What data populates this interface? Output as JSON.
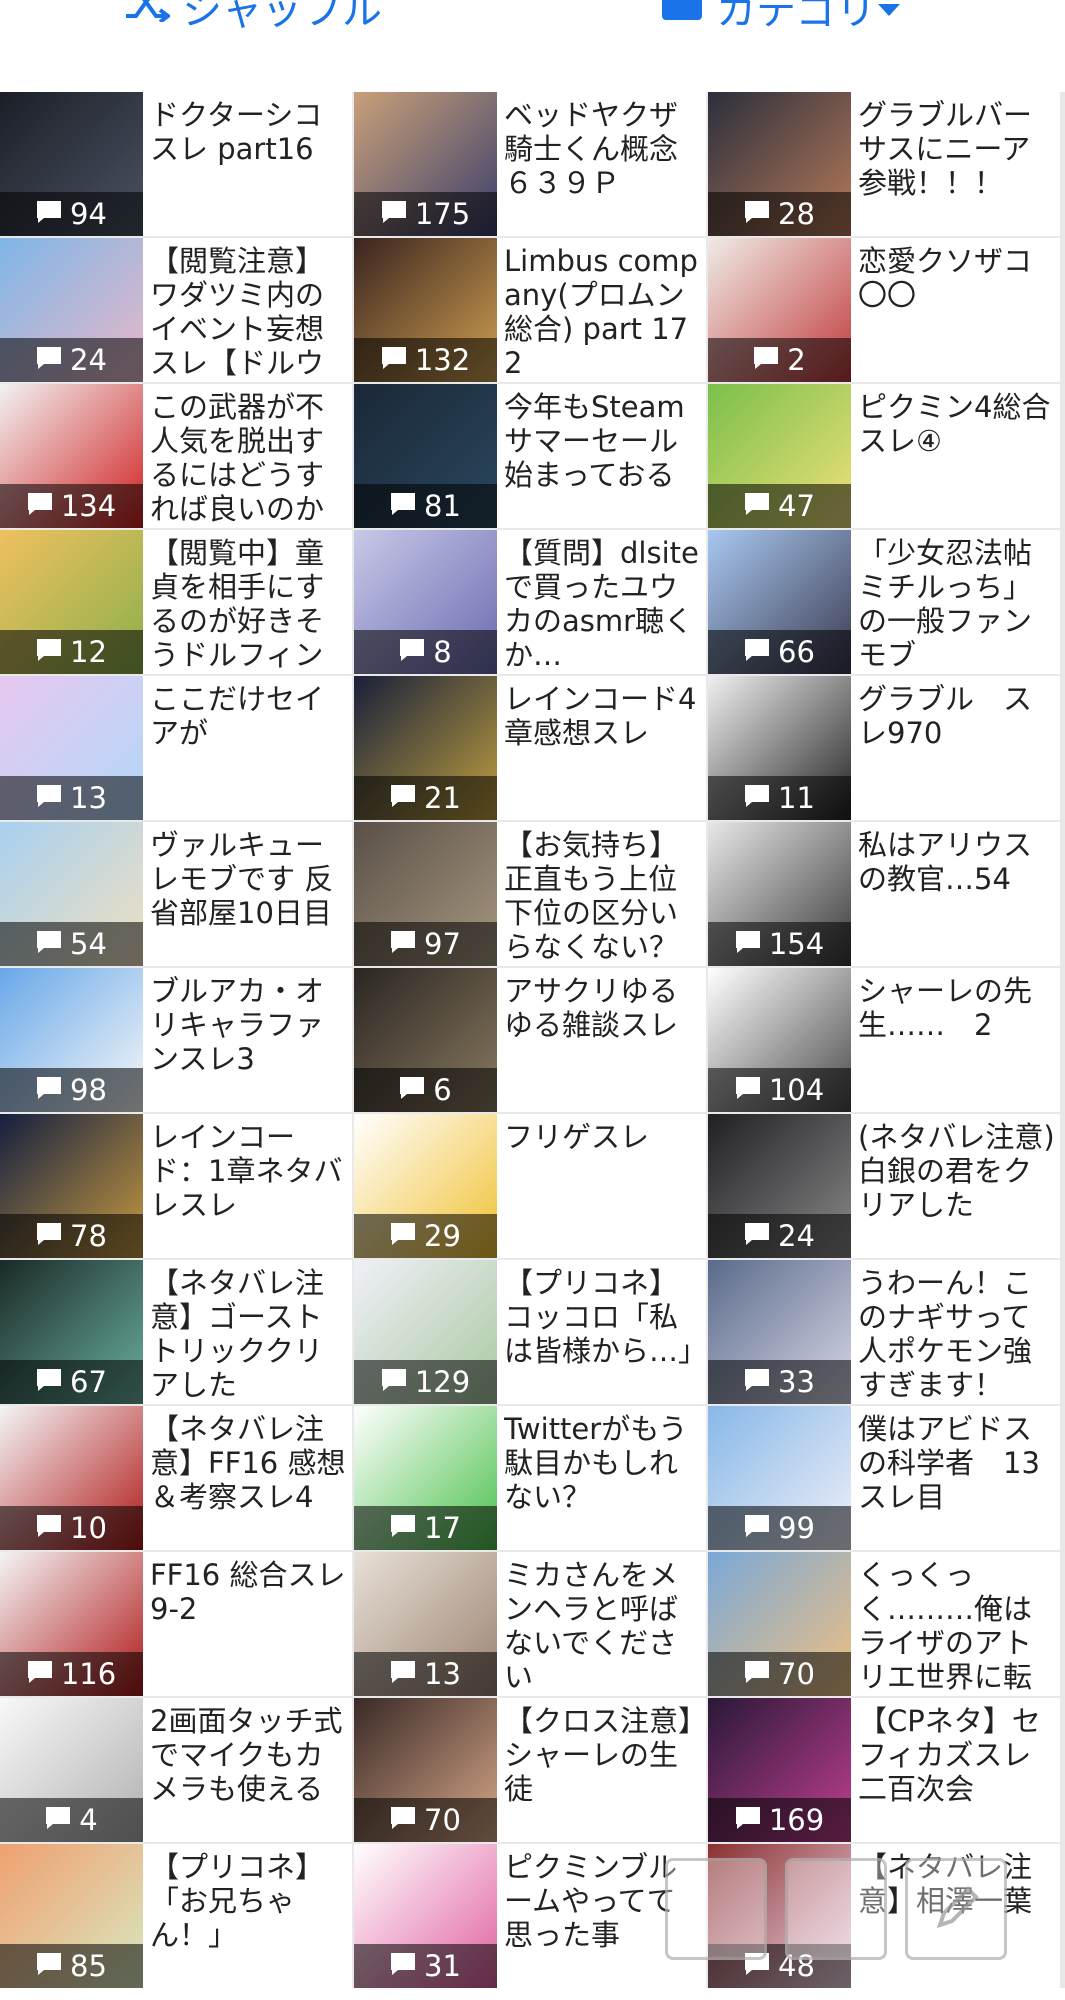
{
  "topbar": {
    "shuffle_label": "シャッフル",
    "category_label": "カテゴリ",
    "accent": "#1a73e8"
  },
  "threads": [
    {
      "title": "ドクターシコスレ part16",
      "count": "94",
      "thumb": [
        "#1c1f26",
        "#4a5364"
      ]
    },
    {
      "title": "ベッドヤクザ騎士くん概念 ６３９Ｐ",
      "count": "175",
      "thumb": [
        "#c9a07a",
        "#3b3f6b"
      ]
    },
    {
      "title": "グラブルバーサスにニーア参戦！！！",
      "count": "28",
      "thumb": [
        "#2b2f3c",
        "#b87a5a"
      ]
    },
    {
      "title": "【閲覧注意】ワダツミ内のイベント妄想スレ【ドルウ",
      "count": "24",
      "thumb": [
        "#7fb6e8",
        "#e8b8c8"
      ]
    },
    {
      "title": "Limbus company(プロムン総合) part 172",
      "count": "132",
      "thumb": [
        "#3a2420",
        "#d0a050"
      ]
    },
    {
      "title": "恋愛クソザコ〇〇",
      "count": "2",
      "thumb": [
        "#f0ebe6",
        "#c03a3a"
      ]
    },
    {
      "title": "この武器が不人気を脱出するにはどうすれば良いのか",
      "count": "134",
      "thumb": [
        "#f2f2f2",
        "#d02020"
      ]
    },
    {
      "title": "今年もSteamサマーセール始まっておる",
      "count": "81",
      "thumb": [
        "#1b2838",
        "#2a475e"
      ]
    },
    {
      "title": "ピクミン4総合スレ④",
      "count": "47",
      "thumb": [
        "#7ac04a",
        "#f0e07a"
      ]
    },
    {
      "title": "【閲覧中】童貞を相手にするのが好きそうドルフィン",
      "count": "12",
      "thumb": [
        "#f0c060",
        "#8ab04a"
      ]
    },
    {
      "title": "【質問】dlsiteで買ったユウカのasmr聴くか…",
      "count": "8",
      "thumb": [
        "#c8c8e8",
        "#6a6ab0"
      ]
    },
    {
      "title": "「少女忍法帖ミチルっち」の一般ファンモブ",
      "count": "66",
      "thumb": [
        "#a8c8f0",
        "#3a3a50"
      ]
    },
    {
      "title": "ここだけセイアが",
      "count": "13",
      "thumb": [
        "#e8c8f0",
        "#b0d8f8"
      ]
    },
    {
      "title": "レインコード4章感想スレ",
      "count": "21",
      "thumb": [
        "#18203a",
        "#c0a040"
      ]
    },
    {
      "title": "グラブル　スレ970",
      "count": "11",
      "thumb": [
        "#f0f0f0",
        "#222222"
      ]
    },
    {
      "title": "ヴァルキューレモブです 反省部屋10日目",
      "count": "54",
      "thumb": [
        "#a8d0f0",
        "#f0e0c0"
      ]
    },
    {
      "title": "【お気持ち】正直もう上位下位の区分いらなくない？",
      "count": "97",
      "thumb": [
        "#5a5048",
        "#a89880"
      ]
    },
    {
      "title": "私はアリウスの教官…54",
      "count": "154",
      "thumb": [
        "#e8e8e8",
        "#3a3a3a"
      ]
    },
    {
      "title": "ブルアカ・オリキャラファンスレ3",
      "count": "98",
      "thumb": [
        "#68a8e8",
        "#f8f8f8"
      ]
    },
    {
      "title": "アサクリゆるゆる雑談スレ",
      "count": "6",
      "thumb": [
        "#2a2622",
        "#8a7a60"
      ]
    },
    {
      "title": "シャーレの先生……　2",
      "count": "104",
      "thumb": [
        "#ffffff",
        "#4a4a4a"
      ]
    },
    {
      "title": "レインコード：1章ネタバレスレ",
      "count": "78",
      "thumb": [
        "#142040",
        "#c89a40"
      ]
    },
    {
      "title": "フリゲスレ",
      "count": "29",
      "thumb": [
        "#ffffff",
        "#f0c030"
      ]
    },
    {
      "title": "(ネタバレ注意)白銀の君をクリアした",
      "count": "24",
      "thumb": [
        "#202024",
        "#8a8a8a"
      ]
    },
    {
      "title": "【ネタバレ注意】ゴーストトリッククリアした",
      "count": "67",
      "thumb": [
        "#1a2a28",
        "#6ab0a0"
      ]
    },
    {
      "title": "【プリコネ】コッコロ「私は皆様から…」",
      "count": "129",
      "thumb": [
        "#f0f0f8",
        "#a8c8a0"
      ]
    },
    {
      "title": "うわーん！このナギサって人ポケモン強すぎます！",
      "count": "33",
      "thumb": [
        "#5a6a8a",
        "#d8d8e8"
      ]
    },
    {
      "title": "【ネタバレ注意】FF16 感想＆考察スレ4",
      "count": "10",
      "thumb": [
        "#f4f4f4",
        "#b01818"
      ]
    },
    {
      "title": "Twitterがもう駄目かもしれない？",
      "count": "17",
      "thumb": [
        "#ffffff",
        "#4ac04a"
      ]
    },
    {
      "title": "僕はアビドスの科学者　13スレ目",
      "count": "99",
      "thumb": [
        "#88b8e8",
        "#f0f0f8"
      ]
    },
    {
      "title": "FF16 総合スレ9-2",
      "count": "116",
      "thumb": [
        "#f4f4f4",
        "#b01818"
      ]
    },
    {
      "title": "ミカさんをメンヘラと呼ばないでください",
      "count": "13",
      "thumb": [
        "#e8e0d8",
        "#9a8270"
      ]
    },
    {
      "title": "くっくっく………俺はライザのアトリエ世界に転",
      "count": "70",
      "thumb": [
        "#7aa8d8",
        "#f0c080"
      ]
    },
    {
      "title": "2画面タッチ式でマイクもカメラも使える",
      "count": "4",
      "thumb": [
        "#f8f8f8",
        "#b0b0b0"
      ]
    },
    {
      "title": "【クロス注意】シャーレの生徒",
      "count": "70",
      "thumb": [
        "#3a2a28",
        "#d8a888"
      ]
    },
    {
      "title": "【CPネタ】セフィカズスレ二百次会",
      "count": "169",
      "thumb": [
        "#2a1838",
        "#c04090"
      ]
    },
    {
      "title": "【プリコネ】「お兄ちゃん！」",
      "count": "85",
      "thumb": [
        "#f0a070",
        "#d8e8c0"
      ]
    },
    {
      "title": "ピクミンブルームやってて思った事",
      "count": "31",
      "thumb": [
        "#ffffff",
        "#e060a0"
      ]
    },
    {
      "title": "【ネタバレ注意】相澤一葉",
      "count": "48",
      "thumb": [
        "#8a3030",
        "#f0d8e8"
      ]
    }
  ]
}
